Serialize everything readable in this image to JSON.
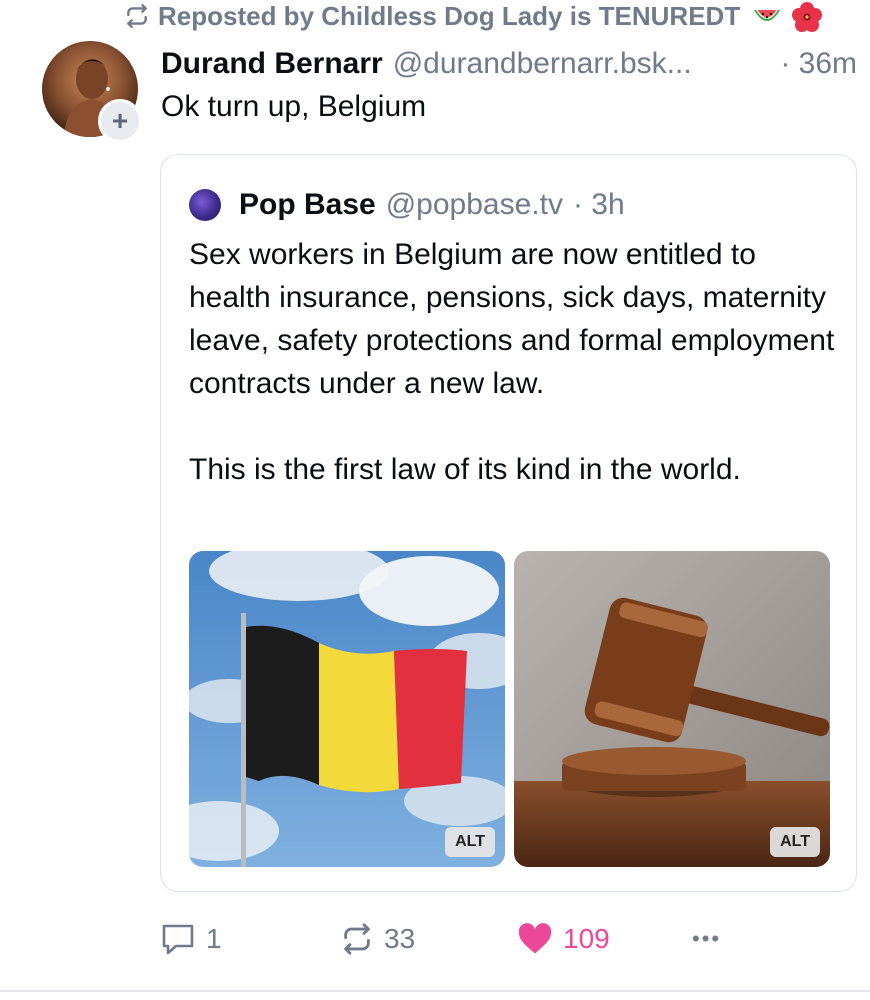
{
  "repost": {
    "text": "Reposted by Childless Dog Lady is TENUREDT",
    "icon": "repost-icon",
    "emojis": [
      "watermelon",
      "hibiscus"
    ]
  },
  "post": {
    "author_name": "Durand Bernarr",
    "author_handle": "@durandbernarr.bsk...",
    "time": "· 36m",
    "text": "Ok turn up, Belgium",
    "avatar_plus": "+"
  },
  "quote": {
    "author_name": "Pop Base",
    "author_handle": "@popbase.tv",
    "time": "· 3h",
    "paragraph_1": "Sex workers in Belgium are now entitled to health insurance, pensions, sick days, maternity leave, safety protections and formal employment contracts under a new law.",
    "paragraph_2": "This is the first law of its kind in the world.",
    "images": [
      {
        "subject": "Belgian flag waving against blue sky",
        "alt_label": "ALT"
      },
      {
        "subject": "Wooden judge gavel",
        "alt_label": "ALT"
      }
    ]
  },
  "actions": {
    "reply_count": "1",
    "repost_count": "33",
    "like_count": "109",
    "more": "•••",
    "like_color": "#ec4899"
  },
  "colors": {
    "muted_text": "#6f7b8a",
    "primary_text": "#0b0f14",
    "card_border": "#dde2e8"
  }
}
